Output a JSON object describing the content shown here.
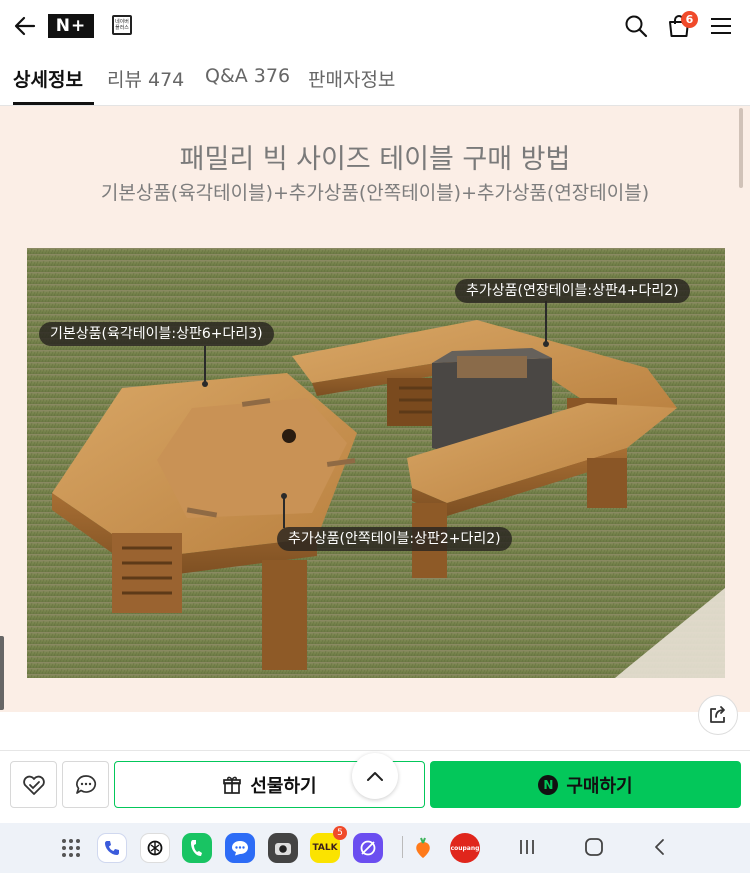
{
  "header": {
    "brand_label": "N+",
    "cart_count": "6",
    "store_icon_text": "네이버 플러스"
  },
  "tabs": [
    {
      "label": "상세정보",
      "active": true
    },
    {
      "label": "리뷰 474",
      "active": false
    },
    {
      "label": "Q&A 376",
      "active": false
    },
    {
      "label": "판매자정보",
      "active": false
    }
  ],
  "content": {
    "title": "패밀리 빅 사이즈 테이블 구매 방법",
    "subtitle": "기본상품(육각테이블)+추가상품(안쪽테이블)+추가상품(연장테이블)",
    "labels": {
      "extension": "추가상품(연장테이블:상판4+다리2)",
      "base": "기본상품(육각테이블:상판6+다리3)",
      "inner": "추가상품(안쪽테이블:상판2+다리2)"
    }
  },
  "actions": {
    "gift_label": "선물하기",
    "buy_label": "구매하기",
    "buy_icon_letter": "N"
  },
  "dock": {
    "talk_badge": "5",
    "talk_label": "TALK",
    "coupang_label": "coupang"
  },
  "colors": {
    "accent_green": "#03c75a",
    "badge_red": "#f04a2a",
    "content_bg": "#fbeee6"
  }
}
